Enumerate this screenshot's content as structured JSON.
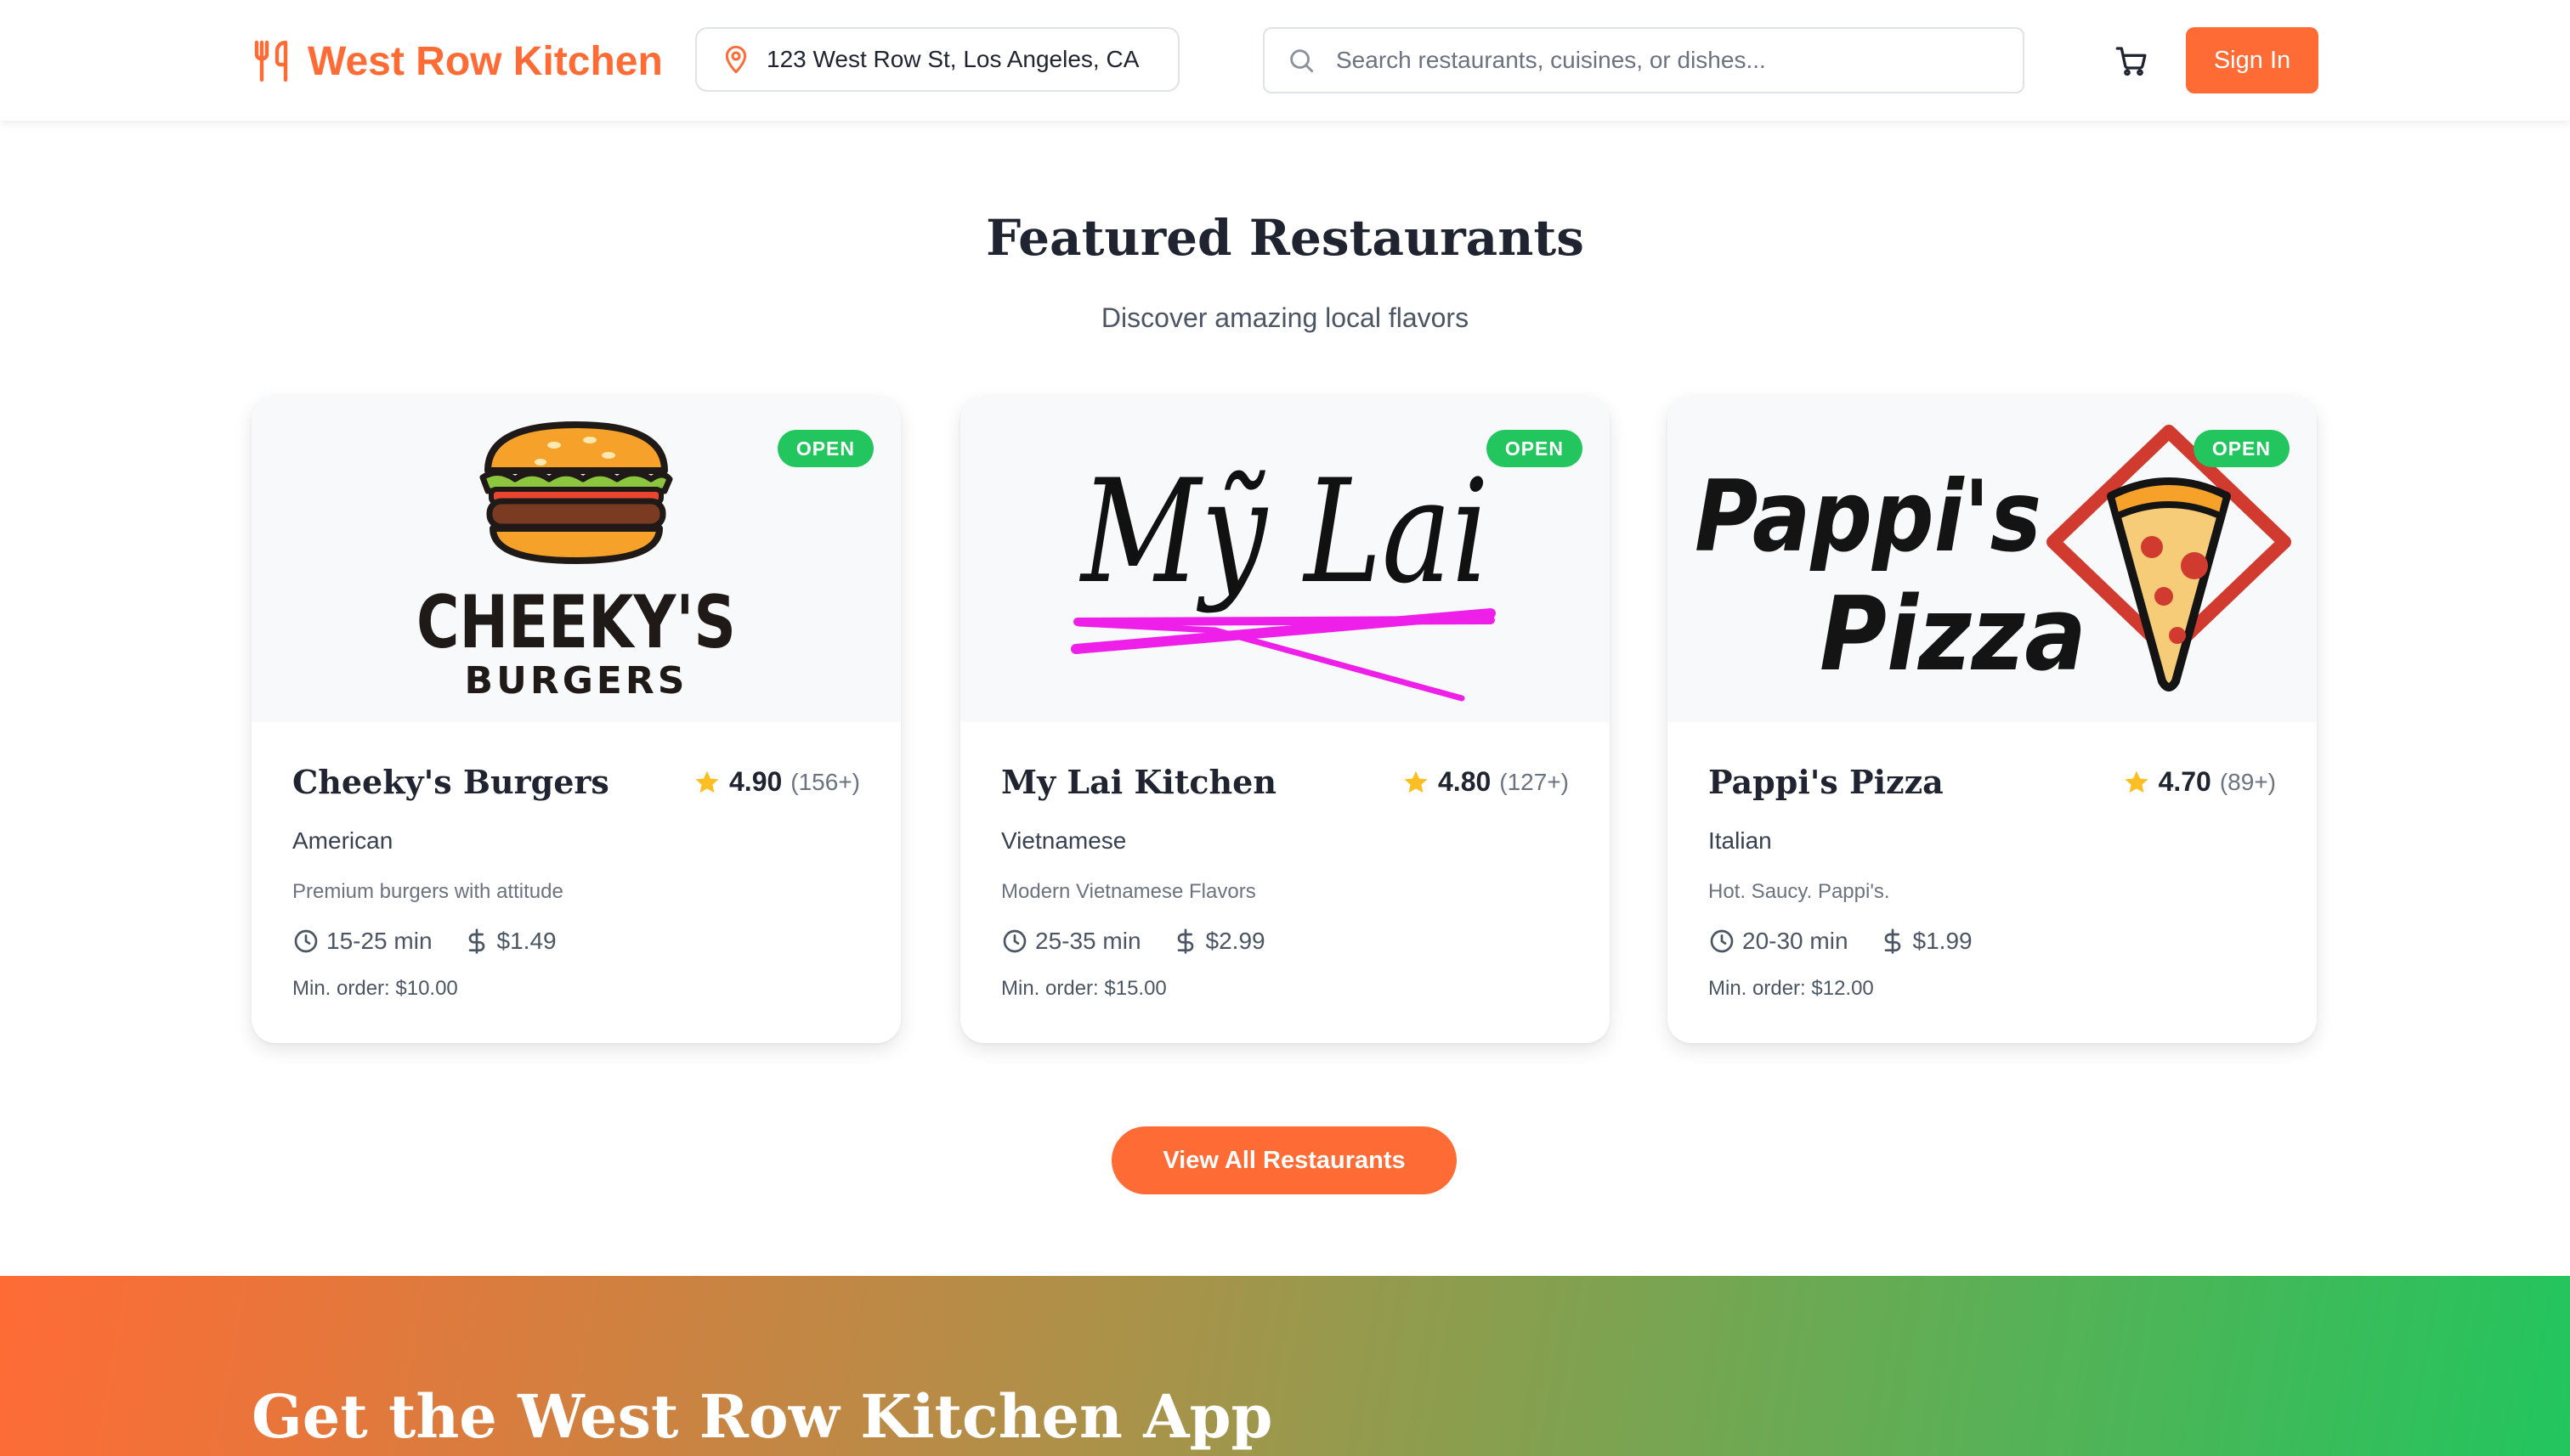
{
  "header": {
    "brand": "West Row Kitchen",
    "address": "123 West Row St, Los Angeles, CA",
    "search_placeholder": "Search restaurants, cuisines, or dishes...",
    "sign_in": "Sign In"
  },
  "section": {
    "title": "Featured Restaurants",
    "subtitle": "Discover amazing local flavors"
  },
  "restaurants": [
    {
      "status": "OPEN",
      "name": "Cheeky's Burgers",
      "rating": "4.90",
      "reviews": "(156+)",
      "cuisine": "American",
      "tagline": "Premium burgers with attitude",
      "time": "15-25 min",
      "fee": "$1.49",
      "min_order": "Min. order: $10.00",
      "logo": {
        "line1": "CHEEKY'S",
        "line2": "BURGERS",
        "icon": "burger-icon"
      }
    },
    {
      "status": "OPEN",
      "name": "My Lai Kitchen",
      "rating": "4.80",
      "reviews": "(127+)",
      "cuisine": "Vietnamese",
      "tagline": "Modern Vietnamese Flavors",
      "time": "25-35 min",
      "fee": "$2.99",
      "min_order": "Min. order: $15.00",
      "logo": {
        "line1": "Mỹ Lai",
        "icon": "chopsticks-icon"
      }
    },
    {
      "status": "OPEN",
      "name": "Pappi's Pizza",
      "rating": "4.70",
      "reviews": "(89+)",
      "cuisine": "Italian",
      "tagline": "Hot. Saucy. Pappi's.",
      "time": "20-30 min",
      "fee": "$1.99",
      "min_order": "Min. order: $12.00",
      "logo": {
        "line1": "Pappi's",
        "line2": "Pizza",
        "icon": "pizza-slice-icon"
      }
    }
  ],
  "view_all": "View All Restaurants",
  "banner": {
    "title": "Get the West Row Kitchen App"
  },
  "colors": {
    "accent": "#ff6b35",
    "open_badge": "#22c55e",
    "star": "#fbbf24",
    "chopsticks": "#ee1fe8",
    "pizza_frame": "#d13b2f"
  }
}
